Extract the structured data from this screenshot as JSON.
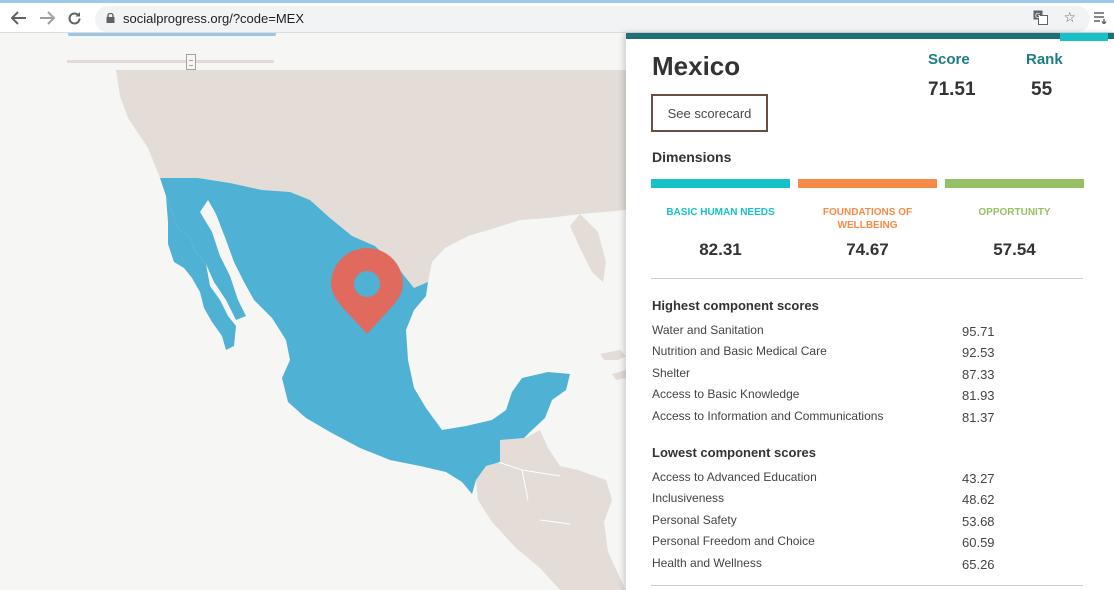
{
  "browser": {
    "url": "socialprogress.org/?code=MEX",
    "icons": [
      "back-arrow-icon",
      "forward-arrow-icon",
      "reload-icon",
      "lock-icon",
      "translate-icon",
      "star-icon",
      "reading-list-icon"
    ]
  },
  "map": {
    "colors": {
      "background": "#f6f6f5",
      "land": "#e3dcd7",
      "selected": "#4fb1d4",
      "marker": "#e06a5e"
    },
    "marker_icon": "location-pin-icon"
  },
  "panel": {
    "country": "Mexico",
    "score_label": "Score",
    "score_value": "71.51",
    "rank_label": "Rank",
    "rank_value": "55",
    "scorecard_button": "See scorecard",
    "dimensions_title": "Dimensions",
    "dimensions": [
      {
        "label": "BASIC HUMAN NEEDS",
        "value": "82.31",
        "color": "#16c2c8"
      },
      {
        "label": "FOUNDATIONS OF WELLBEING",
        "value": "74.67",
        "color": "#f78a48"
      },
      {
        "label": "OPPORTUNITY",
        "value": "57.54",
        "color": "#96c064"
      }
    ],
    "highest_title": "Highest component scores",
    "highest": [
      {
        "name": "Water and Sanitation",
        "value": "95.71"
      },
      {
        "name": "Nutrition and Basic Medical Care",
        "value": "92.53"
      },
      {
        "name": "Shelter",
        "value": "87.33"
      },
      {
        "name": "Access to Basic Knowledge",
        "value": "81.93"
      },
      {
        "name": "Access to Information and Communications",
        "value": "81.37"
      }
    ],
    "lowest_title": "Lowest component scores",
    "lowest": [
      {
        "name": "Access to Advanced Education",
        "value": "43.27"
      },
      {
        "name": "Inclusiveness",
        "value": "48.62"
      },
      {
        "name": "Personal Safety",
        "value": "53.68"
      },
      {
        "name": "Personal Freedom and Choice",
        "value": "60.59"
      },
      {
        "name": "Health and Wellness",
        "value": "65.26"
      }
    ]
  }
}
